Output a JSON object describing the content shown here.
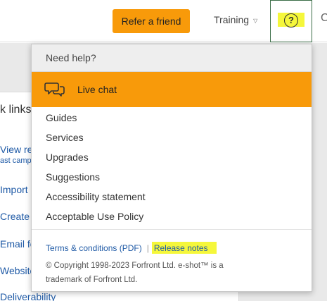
{
  "header": {
    "refer_label": "Refer a friend",
    "training_label": "Training",
    "training_caret": "▽",
    "help_glyph": "?",
    "edge_glyph": "C",
    "accent_color": "#f89a0a",
    "highlight_color": "#f5f73b"
  },
  "background": {
    "quick_links_title": "k links",
    "links": [
      "View rep",
      "Import c",
      "Create n",
      "Email fo",
      "Website",
      "Deliverability"
    ],
    "sub_link": "ast camp"
  },
  "help_menu": {
    "header": "Need help?",
    "live_chat": {
      "label": "Live chat",
      "icon": "chat-bubbles-icon"
    },
    "items": [
      "Guides",
      "Services",
      "Upgrades",
      "Suggestions",
      "Accessibility statement",
      "Acceptable Use Policy"
    ],
    "terms_label": "Terms & conditions (PDF)",
    "separator": "|",
    "release_notes_label": "Release notes",
    "copyright": "© Copyright 1998-2023 Forfront Ltd. e-shot™ is a trademark of Forfront Ltd."
  }
}
